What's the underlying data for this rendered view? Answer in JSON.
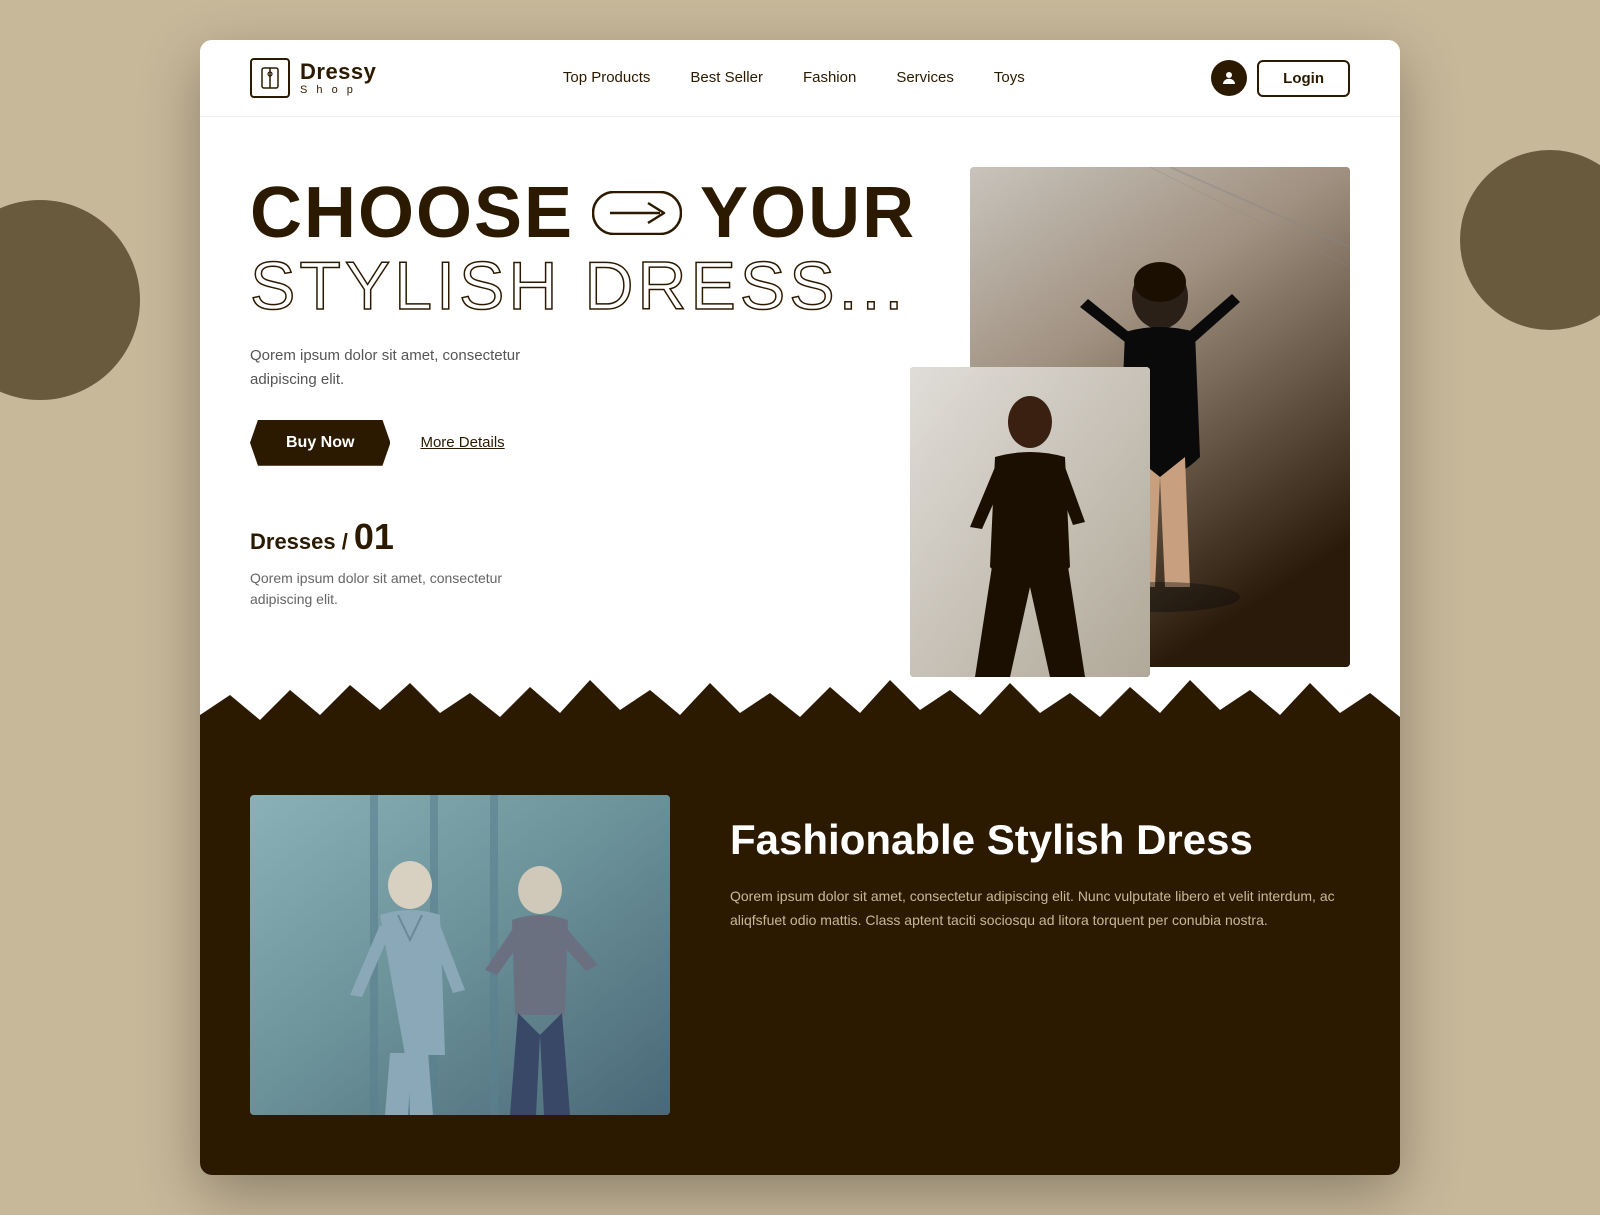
{
  "logo": {
    "brand": "Dressy",
    "sub": "S h o p"
  },
  "nav": {
    "links": [
      {
        "label": "Top Products",
        "href": "#"
      },
      {
        "label": "Best Seller",
        "href": "#"
      },
      {
        "label": "Fashion",
        "href": "#"
      },
      {
        "label": "Services",
        "href": "#"
      },
      {
        "label": "Toys",
        "href": "#"
      }
    ],
    "login": "Login"
  },
  "hero": {
    "heading_choose": "CHOOSE",
    "heading_your": "YOUR",
    "heading_stylish": "STYLISH DRESS...",
    "description": "Qorem ipsum dolor sit amet, consectetur adipiscing elit.",
    "buy_now": "Buy Now",
    "more_details": "More Details",
    "dresses_label": "Dresses /",
    "dresses_number": "01",
    "dresses_desc": "Qorem ipsum dolor sit amet, consectetur adipiscing elit."
  },
  "dark_section": {
    "title": "Fashionable Stylish Dress",
    "description": "Qorem ipsum dolor sit amet, consectetur adipiscing elit. Nunc vulputate libero et velit interdum, ac aliqfsfuet odio mattis. Class aptent taciti sociosqu ad litora torquent per conubia nostra."
  }
}
